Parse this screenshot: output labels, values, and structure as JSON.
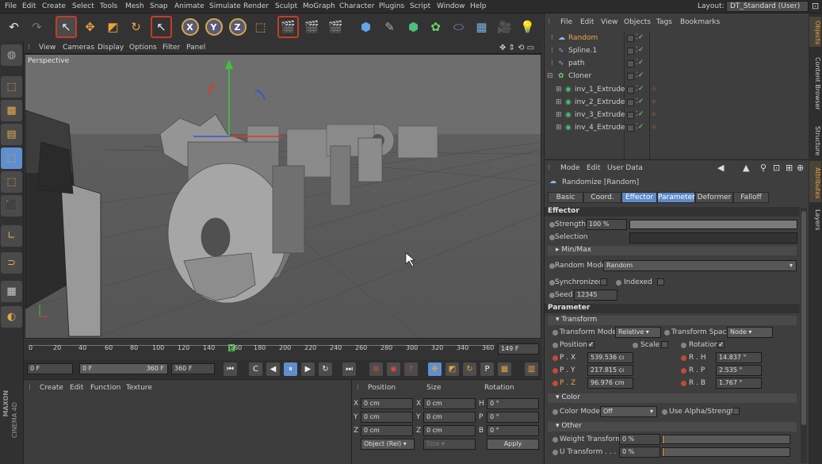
{
  "menubar": {
    "items": [
      "File",
      "Edit",
      "Create",
      "Select",
      "Tools",
      "Mesh",
      "Snap",
      "Animate",
      "Simulate",
      "Render",
      "Sculpt",
      "MoGraph",
      "Character",
      "Plugins",
      "Script",
      "Window",
      "Help"
    ],
    "layout_label": "Layout:",
    "layout_value": "DT_Standard (User)"
  },
  "toolbar": {
    "axis_x": "X",
    "axis_y": "Y",
    "axis_z": "Z"
  },
  "viewport": {
    "menu": [
      "View",
      "Cameras",
      "Display",
      "Options",
      "Filter",
      "Panel"
    ],
    "label": "Perspective"
  },
  "timeline": {
    "ticks": [
      "0",
      "20",
      "40",
      "60",
      "80",
      "100",
      "120",
      "140",
      "160",
      "180",
      "200",
      "220",
      "240",
      "260",
      "280",
      "300",
      "320",
      "340",
      "360"
    ],
    "current": "149 F"
  },
  "playback": {
    "start": "0 F",
    "range_start": "0 F",
    "range_end": "360 F",
    "end": "360 F"
  },
  "material_manager": {
    "menu": [
      "Create",
      "Edit",
      "Function",
      "Texture"
    ]
  },
  "coords": {
    "headers": [
      "Position",
      "Size",
      "Rotation"
    ],
    "rows": [
      {
        "a": "X",
        "pos": "0 cm",
        "s": "X",
        "size": "0 cm",
        "r": "H",
        "rot": "0 °"
      },
      {
        "a": "Y",
        "pos": "0 cm",
        "s": "Y",
        "size": "0 cm",
        "r": "P",
        "rot": "0 °"
      },
      {
        "a": "Z",
        "pos": "0 cm",
        "s": "Z",
        "size": "0 cm",
        "r": "B",
        "rot": "0 °"
      }
    ],
    "mode": "Object (Rel)",
    "size_mode": "Size",
    "apply": "Apply"
  },
  "object_manager": {
    "menu": [
      "File",
      "Edit",
      "View",
      "Objects",
      "Tags",
      "Bookmarks"
    ],
    "objects": [
      {
        "name": "Random",
        "active": true
      },
      {
        "name": "Spline.1"
      },
      {
        "name": "path"
      },
      {
        "name": "Cloner"
      },
      {
        "name": "inv_1_Extrude"
      },
      {
        "name": "inv_2_Extrude"
      },
      {
        "name": "inv_3_Extrude"
      },
      {
        "name": "inv_4_Extrude"
      }
    ]
  },
  "attributes": {
    "menu": [
      "Mode",
      "Edit",
      "User Data"
    ],
    "title": "Randomize [Random]",
    "tabs": [
      "Basic",
      "Coord.",
      "Effector",
      "Parameter",
      "Deformer",
      "Falloff"
    ],
    "effector_head": "Effector",
    "strength_label": "Strength",
    "strength_value": "100 %",
    "selection_label": "Selection",
    "minmax": "Min/Max",
    "random_mode_label": "Random Mode",
    "random_mode_value": "Random",
    "synchronized": "Synchronized",
    "indexed": "Indexed",
    "seed_label": "Seed",
    "seed_value": "12345",
    "parameter_head": "Parameter",
    "transform_head": "Transform",
    "transform_mode_label": "Transform Mode",
    "transform_mode_value": "Relative",
    "transform_space_label": "Transform Space",
    "transform_space_value": "Node",
    "position": "Position",
    "scale": "Scale",
    "rotation": "Rotation",
    "px_label": "P . X",
    "px": "539.536 cı",
    "py_label": "P . Y",
    "py": "217.815 cı",
    "pz_label": "P . Z",
    "pz": "96.976 cm",
    "rh_label": "R . H",
    "rh": "14.837 °",
    "rp_label": "R . P",
    "rp": "2.535 °",
    "rb_label": "R . B",
    "rb": "1.767 °",
    "color_head": "Color",
    "color_mode_label": "Color Mode",
    "color_mode_value": "Off",
    "use_alpha": "Use Alpha/Strength",
    "other_head": "Other",
    "weight_label": "Weight Transform",
    "weight_value": "0 %",
    "u_label": "U Transform . . .",
    "u_value": "0 %"
  },
  "right_tabs": [
    "Objects",
    "Content Browser",
    "Structure",
    "Attributes",
    "Layers"
  ],
  "brand": {
    "line1": "MAXON",
    "line2": "CINEMA 4D"
  }
}
